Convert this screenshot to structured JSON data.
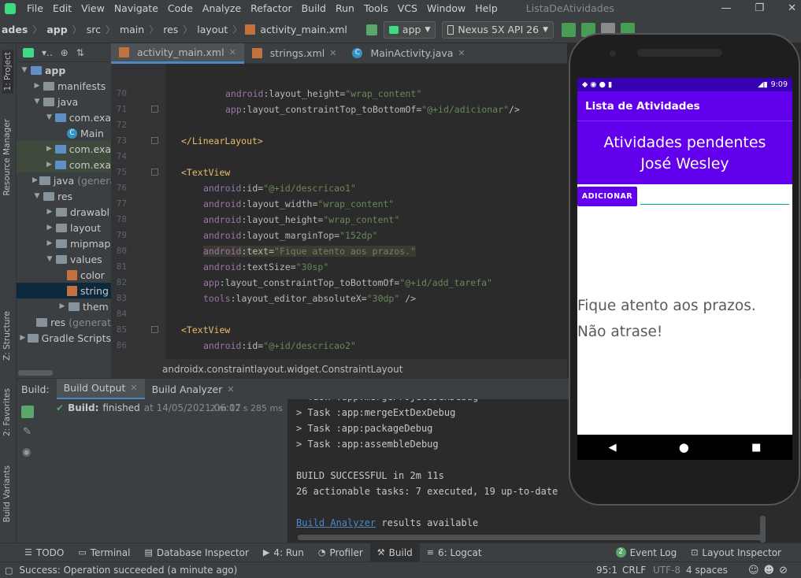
{
  "window": {
    "title": "ListaDeAtividades",
    "menu": [
      "File",
      "Edit",
      "View",
      "Navigate",
      "Code",
      "Analyze",
      "Refactor",
      "Build",
      "Run",
      "Tools",
      "VCS",
      "Window",
      "Help"
    ],
    "controls": [
      "—",
      "❐",
      "✕"
    ]
  },
  "navbar": {
    "breadcrumbs": [
      "ades",
      "app",
      "src",
      "main",
      "res",
      "layout",
      "activity_main.xml"
    ],
    "module_combo": "app",
    "device_combo": "Nexus 5X API 26"
  },
  "left_strip": {
    "top_labels": [
      "1: Project",
      "Resource Manager",
      "Z: Structure"
    ],
    "bottom_labels": [
      "2: Favorites",
      "Build Variants"
    ]
  },
  "project": {
    "header_label": "▾..",
    "tree": [
      {
        "label": "app",
        "suffix": "",
        "icon": "folder-module-icon",
        "arrow": "▼",
        "indent": 0,
        "bold": true
      },
      {
        "label": "manifests",
        "suffix": "",
        "icon": "folder-icon",
        "arrow": "▶",
        "indent": 1
      },
      {
        "label": "java",
        "suffix": "",
        "icon": "folder-icon",
        "arrow": "▼",
        "indent": 1
      },
      {
        "label": "com.exa",
        "suffix": "",
        "icon": "package-icon",
        "arrow": "▼",
        "indent": 2
      },
      {
        "label": "Main",
        "suffix": "",
        "icon": "class-icon",
        "arrow": "",
        "indent": 3
      },
      {
        "label": "com.exa",
        "suffix": "",
        "icon": "package-icon",
        "arrow": "▶",
        "indent": 2,
        "hl": true
      },
      {
        "label": "com.exa",
        "suffix": "",
        "icon": "package-icon",
        "arrow": "▶",
        "indent": 2,
        "hl": true
      },
      {
        "label": "java",
        "suffix": "(genera",
        "icon": "folder-icon",
        "arrow": "▶",
        "indent": 1
      },
      {
        "label": "res",
        "suffix": "",
        "icon": "folder-icon",
        "arrow": "▼",
        "indent": 1
      },
      {
        "label": "drawabl",
        "suffix": "",
        "icon": "folder-icon",
        "arrow": "▶",
        "indent": 2
      },
      {
        "label": "layout",
        "suffix": "",
        "icon": "folder-icon",
        "arrow": "▶",
        "indent": 2
      },
      {
        "label": "mipmap",
        "suffix": "",
        "icon": "folder-icon",
        "arrow": "▶",
        "indent": 2
      },
      {
        "label": "values",
        "suffix": "",
        "icon": "folder-icon",
        "arrow": "▼",
        "indent": 2
      },
      {
        "label": "color",
        "suffix": "",
        "icon": "xml-file-icon",
        "arrow": "",
        "indent": 3
      },
      {
        "label": "string",
        "suffix": "",
        "icon": "xml-file-icon",
        "arrow": "",
        "indent": 3,
        "sel": true
      },
      {
        "label": "them",
        "suffix": "",
        "icon": "folder-icon",
        "arrow": "▶",
        "indent": 3
      },
      {
        "label": "res",
        "suffix": "(generat",
        "icon": "folder-icon",
        "arrow": "",
        "indent": 1
      },
      {
        "label": "Gradle Scripts",
        "suffix": "",
        "icon": "gradle-icon",
        "arrow": "▶",
        "indent": 0
      }
    ]
  },
  "editor": {
    "tabs": [
      {
        "label": "activity_main.xml",
        "active": true,
        "icon": "layout-file-icon"
      },
      {
        "label": "strings.xml",
        "active": false,
        "icon": "xml-file-icon"
      },
      {
        "label": "MainActivity.java",
        "active": false,
        "icon": "class-icon"
      }
    ],
    "lines": [
      {
        "n": "70",
        "indent": 2,
        "parts": [
          [
            "ns",
            "android"
          ],
          [
            "at",
            ":layout_height="
          ],
          [
            "sv",
            "\"wrap_content\""
          ]
        ]
      },
      {
        "n": "71",
        "indent": 2,
        "parts": [
          [
            "ns",
            "app"
          ],
          [
            "at",
            ":layout_constraintTop_toBottomOf="
          ],
          [
            "sv",
            "\"@+id/adicionar\""
          ],
          [
            "at",
            "/>"
          ]
        ]
      },
      {
        "n": "72",
        "indent": 0,
        "parts": []
      },
      {
        "n": "73",
        "indent": 0,
        "parts": [
          [
            "tg",
            "</LinearLayout>"
          ]
        ]
      },
      {
        "n": "74",
        "indent": 0,
        "parts": []
      },
      {
        "n": "75",
        "indent": 0,
        "parts": [
          [
            "tg",
            "<TextView"
          ]
        ]
      },
      {
        "n": "76",
        "indent": 1,
        "parts": [
          [
            "ns",
            "android"
          ],
          [
            "at",
            ":id="
          ],
          [
            "sv",
            "\"@+id/descricao1\""
          ]
        ]
      },
      {
        "n": "77",
        "indent": 1,
        "parts": [
          [
            "ns",
            "android"
          ],
          [
            "at",
            ":layout_width="
          ],
          [
            "sv",
            "\"wrap_content\""
          ]
        ]
      },
      {
        "n": "78",
        "indent": 1,
        "parts": [
          [
            "ns",
            "android"
          ],
          [
            "at",
            ":layout_height="
          ],
          [
            "sv",
            "\"wrap_content\""
          ]
        ]
      },
      {
        "n": "79",
        "indent": 1,
        "parts": [
          [
            "ns",
            "android"
          ],
          [
            "at",
            ":layout_marginTop="
          ],
          [
            "sv",
            "\"152dp\""
          ]
        ]
      },
      {
        "n": "80",
        "indent": 1,
        "hl": true,
        "parts": [
          [
            "ns",
            "android"
          ],
          [
            "at",
            ":text="
          ],
          [
            "sv",
            "\"Fique atento aos prazos.\""
          ]
        ]
      },
      {
        "n": "81",
        "indent": 1,
        "parts": [
          [
            "ns",
            "android"
          ],
          [
            "at",
            ":textSize="
          ],
          [
            "sv",
            "\"30sp\""
          ]
        ]
      },
      {
        "n": "82",
        "indent": 1,
        "parts": [
          [
            "ns",
            "app"
          ],
          [
            "at",
            ":layout_constraintTop_toBottomOf="
          ],
          [
            "sv",
            "\"@+id/add_tarefa\""
          ]
        ]
      },
      {
        "n": "83",
        "indent": 1,
        "parts": [
          [
            "ns",
            "tools"
          ],
          [
            "at",
            ":layout_editor_absoluteX="
          ],
          [
            "sv",
            "\"30dp\""
          ],
          [
            "at",
            " />"
          ]
        ]
      },
      {
        "n": "84",
        "indent": 0,
        "parts": []
      },
      {
        "n": "85",
        "indent": 0,
        "parts": [
          [
            "tg",
            "<TextView"
          ]
        ]
      },
      {
        "n": "86",
        "indent": 1,
        "parts": [
          [
            "ns",
            "android"
          ],
          [
            "at",
            ":id="
          ],
          [
            "sv",
            "\"@+id/descricao2\""
          ]
        ]
      }
    ],
    "breadcrumb": "androidx.constraintlayout.widget.ConstraintLayout"
  },
  "build": {
    "label": "Build:",
    "tabs": [
      "Build Output",
      "Build Analyzer"
    ],
    "status_bold": "Build:",
    "status_text": "finished",
    "status_time": "at 14/05/2021 06:07",
    "duration": "2 m 12 s 285 ms",
    "console": [
      "> Task :app:mergeProjectDexDebug",
      "> Task :app:mergeExtDexDebug",
      "> Task :app:packageDebug",
      "> Task :app:assembleDebug",
      "",
      "BUILD SUCCESSFUL in 2m 11s",
      "26 actionable tasks: 7 executed, 19 up-to-date",
      ""
    ],
    "analyzer_link": "Build Analyzer",
    "analyzer_rest": " results available"
  },
  "bottom_tools": [
    {
      "label": "TODO",
      "icon": "list-icon"
    },
    {
      "label": "Terminal",
      "icon": "terminal-icon"
    },
    {
      "label": "Database Inspector",
      "icon": "database-icon"
    },
    {
      "label": "4: Run",
      "icon": "run-icon"
    },
    {
      "label": "Profiler",
      "icon": "profiler-icon"
    },
    {
      "label": "Build",
      "icon": "hammer-icon",
      "active": true
    },
    {
      "label": "6: Logcat",
      "icon": "logcat-icon"
    }
  ],
  "bottom_right_tools": [
    {
      "label": "Event Log",
      "badge": "2"
    },
    {
      "label": "Layout Inspector",
      "badge": ""
    }
  ],
  "status": {
    "message": "Success: Operation succeeded (a minute ago)",
    "position": "95:1",
    "line_sep": "CRLF",
    "encoding": "UTF-8",
    "indent": "4 spaces"
  },
  "phone": {
    "time": "9:09",
    "app_title": "Lista de Atividades",
    "header_line1": "Atividades pendentes",
    "header_line2": "José Wesley",
    "add_button": "ADICIONAR",
    "text1": "Fique atento aos prazos.",
    "text2": "Não atrase!"
  },
  "colors": {
    "accent": "#4a88c7",
    "phone_primary": "#6200ee",
    "phone_primary_dark": "#3700b3"
  }
}
